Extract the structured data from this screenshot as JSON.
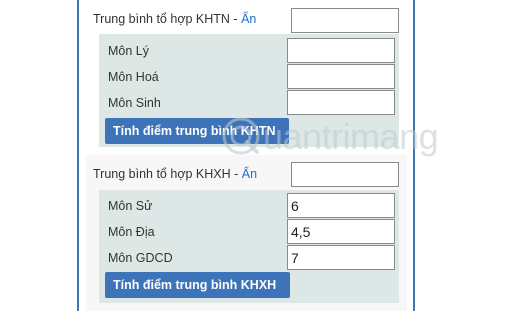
{
  "khtn": {
    "title": "Trung bình tổ hợp KHTN - ",
    "hide_link": "Ẩn",
    "total_value": "",
    "subjects": [
      {
        "label": "Môn Lý",
        "value": ""
      },
      {
        "label": "Môn Hoá",
        "value": ""
      },
      {
        "label": "Môn Sinh",
        "value": ""
      }
    ],
    "button_label": "Tính điểm trung bình KHTN"
  },
  "khxh": {
    "title": "Trung bình tổ hợp KHXH - ",
    "hide_link": "Ẩn",
    "total_value": "",
    "subjects": [
      {
        "label": "Môn Sử",
        "value": "6"
      },
      {
        "label": "Môn Địa",
        "value": "4,5"
      },
      {
        "label": "Môn GDCD",
        "value": "7"
      }
    ],
    "button_label": "Tính điểm trung bình KHXH"
  },
  "watermark": {
    "text": "uantrimang",
    "icon": "quantrimang-logo-icon"
  },
  "colors": {
    "button": "#3d73b9",
    "panel": "#dde8e6",
    "link": "#1d72c6",
    "frame_border": "#3a78b6"
  }
}
